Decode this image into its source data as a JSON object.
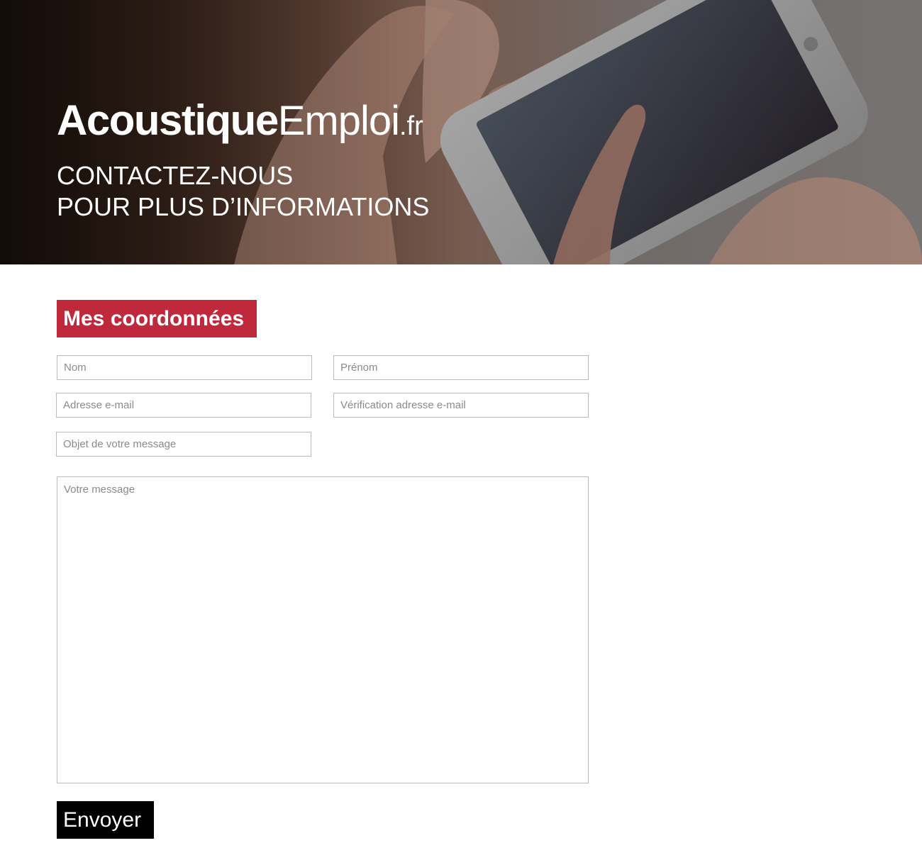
{
  "hero": {
    "logo_bold": "Acoustique",
    "logo_light": "Emploi",
    "logo_suffix": ".fr",
    "tagline_line1": "CONTACTEZ-NOUS",
    "tagline_line2": "POUR PLUS D’INFORMATIONS"
  },
  "form": {
    "section_title": "Mes coordonnées",
    "fields": {
      "nom": {
        "placeholder": "Nom",
        "value": ""
      },
      "prenom": {
        "placeholder": "Prénom",
        "value": ""
      },
      "email": {
        "placeholder": "Adresse e-mail",
        "value": ""
      },
      "email_verify": {
        "placeholder": "Vérification adresse e-mail",
        "value": ""
      },
      "subject": {
        "placeholder": "Objet de votre message",
        "value": ""
      },
      "message": {
        "placeholder": "Votre message",
        "value": ""
      }
    },
    "submit_label": "Envoyer"
  },
  "colors": {
    "accent": "#c0283b",
    "button": "#000000",
    "border": "#b9b9b9"
  }
}
